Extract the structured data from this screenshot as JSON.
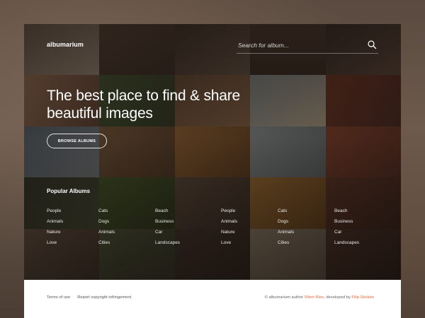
{
  "app": {
    "logo_text": "albumarium"
  },
  "search": {
    "placeholder": "Search for album...",
    "icon": "search-icon"
  },
  "hero": {
    "headline_line1": "The best place to find & share",
    "headline_line2": "beautiful images",
    "browse_button_label": "BROWSE ALBUMS"
  },
  "popular": {
    "title": "Popular Albums",
    "columns": [
      [
        "People",
        "Animals",
        "Nature",
        "Love"
      ],
      [
        "Cats",
        "Dogs",
        "Animals",
        "Cities"
      ],
      [
        "Beach",
        "Business",
        "Car",
        "Landscapes"
      ],
      [
        "People",
        "Animals",
        "Nature",
        "Love"
      ],
      [
        "Cats",
        "Dogs",
        "Animals",
        "Cities"
      ],
      [
        "Beach",
        "Business",
        "Car",
        "Landscapes"
      ]
    ]
  },
  "footer": {
    "terms_label": "Terms of use",
    "report_label": "Report copyright infringement",
    "credits_prefix": "© albumarium author ",
    "author_name": "Vilem Ries",
    "credits_middle": ", developed by ",
    "developer_name": "Filip Skokan"
  },
  "colors": {
    "accent": "#e86a3a",
    "footer_bg": "#ffffff",
    "hero_overlay": "#19120e"
  }
}
